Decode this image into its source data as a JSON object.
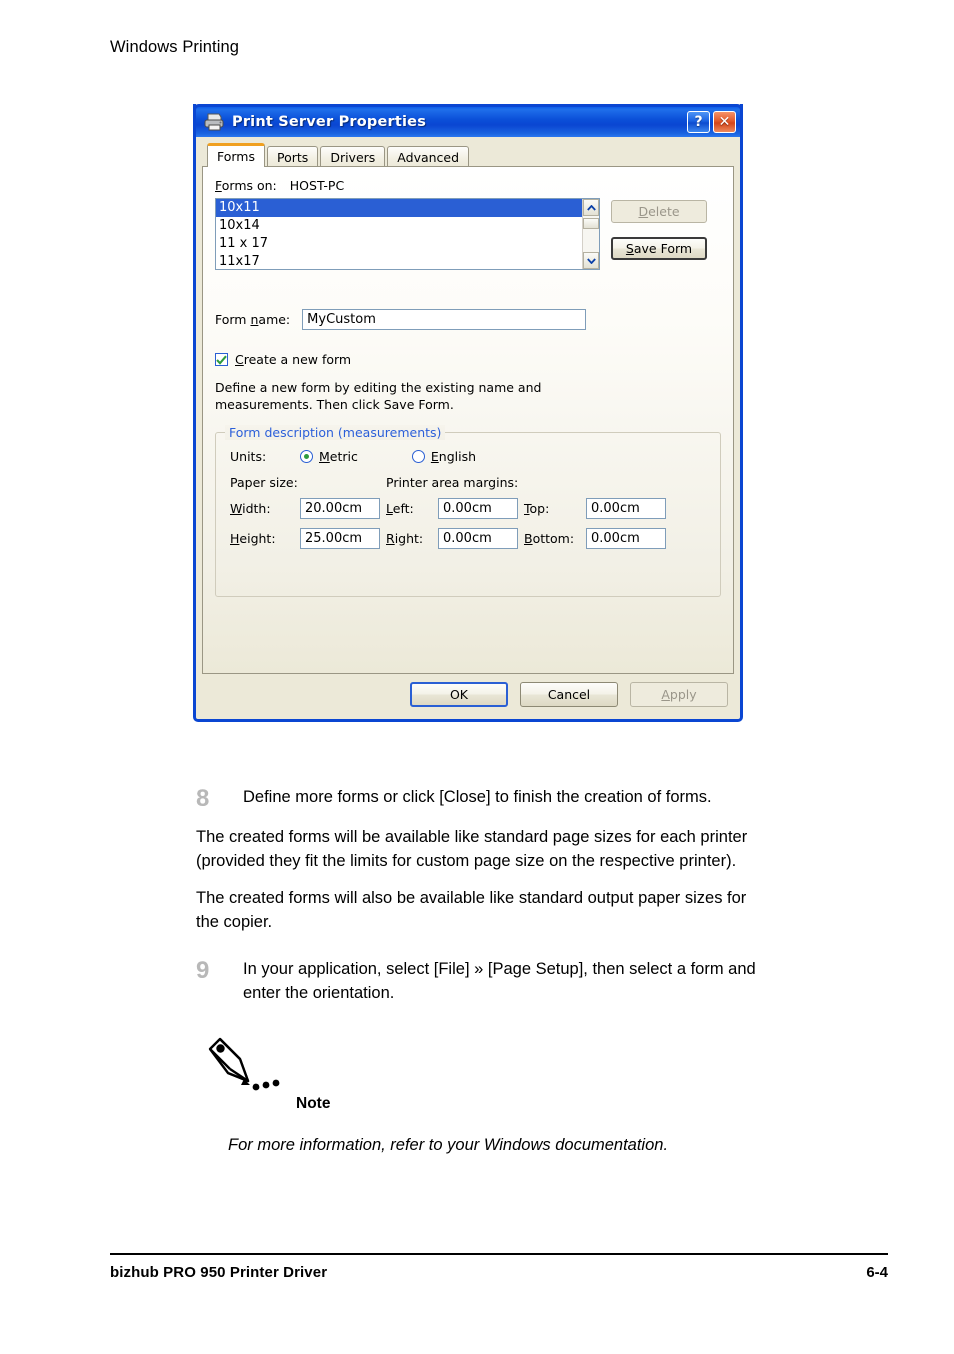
{
  "page": {
    "header": "Windows Printing",
    "footer_left": "bizhub PRO 950 Printer Driver",
    "footer_right": "6-4"
  },
  "dialog": {
    "title": "Print Server Properties",
    "icons": {
      "app": "printer-icon",
      "help": "?",
      "close": "✕"
    },
    "tabs": [
      {
        "label": "Forms",
        "active": true
      },
      {
        "label": "Ports",
        "active": false
      },
      {
        "label": "Drivers",
        "active": false
      },
      {
        "label": "Advanced",
        "active": false
      }
    ],
    "forms_on": {
      "label": "Forms on:",
      "value": "HOST-PC"
    },
    "forms_list": {
      "items": [
        "10x11",
        "10x14",
        "11 x 17",
        "11x17"
      ],
      "selected_index": 0
    },
    "side_buttons": [
      {
        "label": "Delete",
        "enabled": false
      },
      {
        "label": "Save Form",
        "enabled": true
      }
    ],
    "form_name": {
      "label": "Form name:",
      "value": "MyCustom"
    },
    "create_new_form": {
      "label": "Create a new form",
      "checked": true
    },
    "description_line1": "Define a new form by editing the existing name and",
    "description_line2": "measurements.  Then click Save Form.",
    "group": {
      "title": "Form description (measurements)",
      "units_label": "Units:",
      "units_options": [
        {
          "label": "Metric",
          "selected": true
        },
        {
          "label": "English",
          "selected": false
        }
      ],
      "paper_size_header": "Paper size:",
      "margins_header": "Printer area margins:",
      "fields": {
        "width_label": "Width:",
        "width_value": "20.00cm",
        "height_label": "Height:",
        "height_value": "25.00cm",
        "left_label": "Left:",
        "left_value": "0.00cm",
        "right_label": "Right:",
        "right_value": "0.00cm",
        "top_label": "Top:",
        "top_value": "0.00cm",
        "bottom_label": "Bottom:",
        "bottom_value": "0.00cm"
      }
    },
    "buttons": [
      {
        "label": "OK",
        "state": "default"
      },
      {
        "label": "Cancel",
        "state": "normal"
      },
      {
        "label": "Apply",
        "state": "disabled"
      }
    ],
    "colors": {
      "titlebar": "#0a46d2",
      "dialog_face": "#ece9d8",
      "selection": "#2a5fd4",
      "group_label": "#2b5fd9",
      "active_tab_accent": "#f0a020",
      "close_button": "#d4451b"
    }
  },
  "content": {
    "step8": {
      "number": "8",
      "text": "Define more forms or click [Close] to finish the creation of forms."
    },
    "para1_line1": "The created forms will be available like standard page sizes for each printer",
    "para1_line2": "(provided they fit the limits for custom page size on the respective printer).",
    "para2_line1": "The created forms will also be available like standard output paper sizes for",
    "para2_line2": "the copier.",
    "step9": {
      "number": "9",
      "line1": "In your application, select [File] » [Page Setup], then select a form and",
      "line2": "enter the orientation."
    },
    "note": {
      "label": "Note",
      "text": "For more information, refer to your Windows documentation."
    }
  }
}
